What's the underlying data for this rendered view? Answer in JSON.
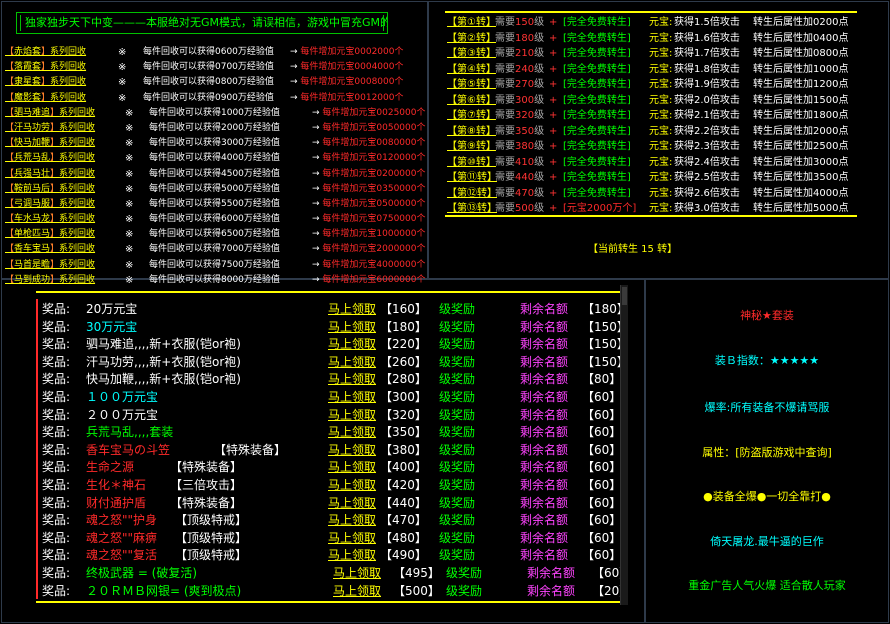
{
  "notice": "独家独步天下中变———本服绝对无GM模式，请误相信，游戏中冒充GM的均为骗子",
  "recycle": {
    "mark": "※",
    "arrow": "→",
    "rows": [
      {
        "name": "赤焰套",
        "mid": "每件回收可以获得0600万经验值",
        "add": "每件增加元宝0002000个"
      },
      {
        "name": "落霞套",
        "mid": "每件回收可以获得0700万经验值",
        "add": "每件增加元宝0004000个"
      },
      {
        "name": "隶星套",
        "mid": "每件回收可以获得0800万经验值",
        "add": "每件增加元宝0008000个"
      },
      {
        "name": "魔影套",
        "mid": "每件回收可以获得0900万经验值",
        "add": "每件增加元宝0012000个"
      },
      {
        "name": "驷马难追",
        "mid": "每件回收可以获得1000万经验值",
        "add": "每件增加元宝0025000个"
      },
      {
        "name": "汗马功劳",
        "mid": "每件回收可以获得2000万经验值",
        "add": "每件增加元宝0050000个"
      },
      {
        "name": "快马加鞭",
        "mid": "每件回收可以获得3000万经验值",
        "add": "每件增加元宝0080000个"
      },
      {
        "name": "兵荒马乱",
        "mid": "每件回收可以获得4000万经验值",
        "add": "每件增加元宝0120000个"
      },
      {
        "name": "兵强马壮",
        "mid": "每件回收可以获得4500万经验值",
        "add": "每件增加元宝0200000个"
      },
      {
        "name": "鞍前马后",
        "mid": "每件回收可以获得5000万经验值",
        "add": "每件增加元宝0350000个"
      },
      {
        "name": "弓调马服",
        "mid": "每件回收可以获得5500万经验值",
        "add": "每件增加元宝0500000个"
      },
      {
        "name": "车水马龙",
        "mid": "每件回收可以获得6000万经验值",
        "add": "每件增加元宝0750000个"
      },
      {
        "name": "单枪匹马",
        "mid": "每件回收可以获得6500万经验值",
        "add": "每件增加元宝1000000个"
      },
      {
        "name": "香车宝马",
        "mid": "每件回收可以获得7000万经验值",
        "add": "每件增加元宝2000000个"
      },
      {
        "name": "马首是瞻",
        "mid": "每件回收可以获得7500万经验值",
        "add": "每件增加元宝4000000个"
      },
      {
        "name": "马到成功",
        "mid": "每件回收可以获得8000万经验值",
        "add": "每件增加元宝6000000个"
      }
    ],
    "suffix": "系列回收"
  },
  "rebirth": {
    "rows": [
      {
        "lv": "【第①转】",
        "req_a": "需要",
        "req_n": "150",
        "req_b": "级",
        "free": "[完全免费转生]",
        "yb_val": "获得1.5倍攻击",
        "prop": "转生后属性加0200点"
      },
      {
        "lv": "【第②转】",
        "req_a": "需要",
        "req_n": "180",
        "req_b": "级",
        "free": "[完全免费转生]",
        "yb_val": "获得1.6倍攻击",
        "prop": "转生后属性加0400点"
      },
      {
        "lv": "【第③转】",
        "req_a": "需要",
        "req_n": "210",
        "req_b": "级",
        "free": "[完全免费转生]",
        "yb_val": "获得1.7倍攻击",
        "prop": "转生后属性加0800点"
      },
      {
        "lv": "【第④转】",
        "req_a": "需要",
        "req_n": "240",
        "req_b": "级",
        "free": "[完全免费转生]",
        "yb_val": "获得1.8倍攻击",
        "prop": "转生后属性加1000点"
      },
      {
        "lv": "【第⑤转】",
        "req_a": "需要",
        "req_n": "270",
        "req_b": "级",
        "free": "[完全免费转生]",
        "yb_val": "获得1.9倍攻击",
        "prop": "转生后属性加1200点"
      },
      {
        "lv": "【第⑥转】",
        "req_a": "需要",
        "req_n": "300",
        "req_b": "级",
        "free": "[完全免费转生]",
        "yb_val": "获得2.0倍攻击",
        "prop": "转生后属性加1500点"
      },
      {
        "lv": "【第⑦转】",
        "req_a": "需要",
        "req_n": "320",
        "req_b": "级",
        "free": "[完全免费转生]",
        "yb_val": "获得2.1倍攻击",
        "prop": "转生后属性加1800点"
      },
      {
        "lv": "【第⑧转】",
        "req_a": "需要",
        "req_n": "350",
        "req_b": "级",
        "free": "[完全免费转生]",
        "yb_val": "获得2.2倍攻击",
        "prop": "转生后属性加2000点"
      },
      {
        "lv": "【第⑨转】",
        "req_a": "需要",
        "req_n": "380",
        "req_b": "级",
        "free": "[完全免费转生]",
        "yb_val": "获得2.3倍攻击",
        "prop": "转生后属性加2500点"
      },
      {
        "lv": "【第⑩转】",
        "req_a": "需要",
        "req_n": "410",
        "req_b": "级",
        "free": "[完全免费转生]",
        "yb_val": "获得2.4倍攻击",
        "prop": "转生后属性加3000点"
      },
      {
        "lv": "【第⑪转】",
        "req_a": "需要",
        "req_n": "440",
        "req_b": "级",
        "free": "[完全免费转生]",
        "yb_val": "获得2.5倍攻击",
        "prop": "转生后属性加3500点"
      },
      {
        "lv": "【第⑫转】",
        "req_a": "需要",
        "req_n": "470",
        "req_b": "级",
        "free": "[完全免费转生]",
        "yb_val": "获得2.6倍攻击",
        "prop": "转生后属性加4000点"
      },
      {
        "lv": "【第⑬转】",
        "req_a": "需要",
        "req_n": "500",
        "req_b": "级",
        "free": "[元宝2000万个]",
        "free_red": true,
        "yb_val": "获得3.0倍攻击",
        "prop": "转生后属性加5000点"
      }
    ],
    "plus": "+",
    "yb_label": "元宝:",
    "current": "【当前转生  15  转】"
  },
  "rewards": {
    "label": "奖品:",
    "claim": "马上领取",
    "jl": "级奖励",
    "rem": "剩余名额",
    "rows": [
      {
        "name": "20万元宝",
        "color": "#ffffff",
        "level": "【160】",
        "count": "【180】"
      },
      {
        "name": "30万元宝",
        "color": "#00ffff",
        "level": "【180】",
        "count": "【150】"
      },
      {
        "name": "驷马难追,,,,新+衣服(铠or袍)",
        "color": "#ffffff",
        "level": "【220】",
        "count": "【150】"
      },
      {
        "name": "汗马功劳,,,,新+衣服(铠or袍)",
        "color": "#ffffff",
        "level": "【260】",
        "count": "【150】"
      },
      {
        "name": "快马加鞭,,,,新+衣服(铠or袍)",
        "color": "#ffffff",
        "level": "【280】",
        "count": "【80】"
      },
      {
        "name": "１００万元宝",
        "color": "#00ffff",
        "level": "【300】",
        "count": "【60】"
      },
      {
        "name": "２００万元宝",
        "color": "#ffffff",
        "level": "【320】",
        "count": "【60】"
      },
      {
        "name": "兵荒马乱,,,,套装",
        "color": "#00ff00",
        "level": "【350】",
        "count": "【60】"
      },
      {
        "name": "香车宝马の斗笠",
        "tag": "【特殊装备】",
        "color": "#ff2a2a",
        "level": "【380】",
        "count": "【60】"
      },
      {
        "name": "生命之源",
        "tag": "【特殊装备】",
        "color": "#ff2a2a",
        "level": "【400】",
        "count": "【60】"
      },
      {
        "name": "生化＊神石",
        "tag": "【三倍攻击】",
        "color": "#ff2a2a",
        "level": "【420】",
        "count": "【60】"
      },
      {
        "name": "财付通护盾",
        "tag": "【特殊装备】",
        "color": "#ff2a2a",
        "level": "【440】",
        "count": "【60】"
      },
      {
        "name": "魂之怒\"\"护身",
        "tag": "【顶级特戒】",
        "color": "#ff2a2a",
        "level": "【470】",
        "count": "【60】"
      },
      {
        "name": "魂之怒\"\"麻痹",
        "tag": "【顶级特戒】",
        "color": "#ff2a2a",
        "level": "【480】",
        "count": "【60】"
      },
      {
        "name": "魂之怒\"\"复活",
        "tag": "【顶级特戒】",
        "color": "#ff2a2a",
        "level": "【490】",
        "count": "【60】"
      },
      {
        "name": "终极武器 = (破复活)",
        "color": "#00ff00",
        "level": "【495】",
        "count": "【60】",
        "shift": true
      },
      {
        "name": "２０ＲＭＢ网银= (爽到极点)",
        "color": "#00ff00",
        "level": "【500】",
        "count": "【20】",
        "shift": true
      }
    ]
  },
  "side": {
    "items": [
      {
        "text": "神秘★套装",
        "color": "#ff2a2a"
      },
      {
        "text": "装Ｂ指数：★★★★★",
        "color": "#00ffff"
      },
      {
        "text": "爆率:所有装备不爆请骂服",
        "color": "#00ffff"
      },
      {
        "text": "属性：[防盗版游戏中查询]",
        "color": "#ffff00"
      },
      {
        "text": "●装备全爆●一切全靠打●",
        "color": "#ffff00"
      },
      {
        "text": "倚天屠龙.最牛逼的巨作",
        "color": "#00ffff"
      },
      {
        "text": "重金广告人气火爆 适合散人玩家",
        "color": "#00ff00"
      }
    ]
  }
}
